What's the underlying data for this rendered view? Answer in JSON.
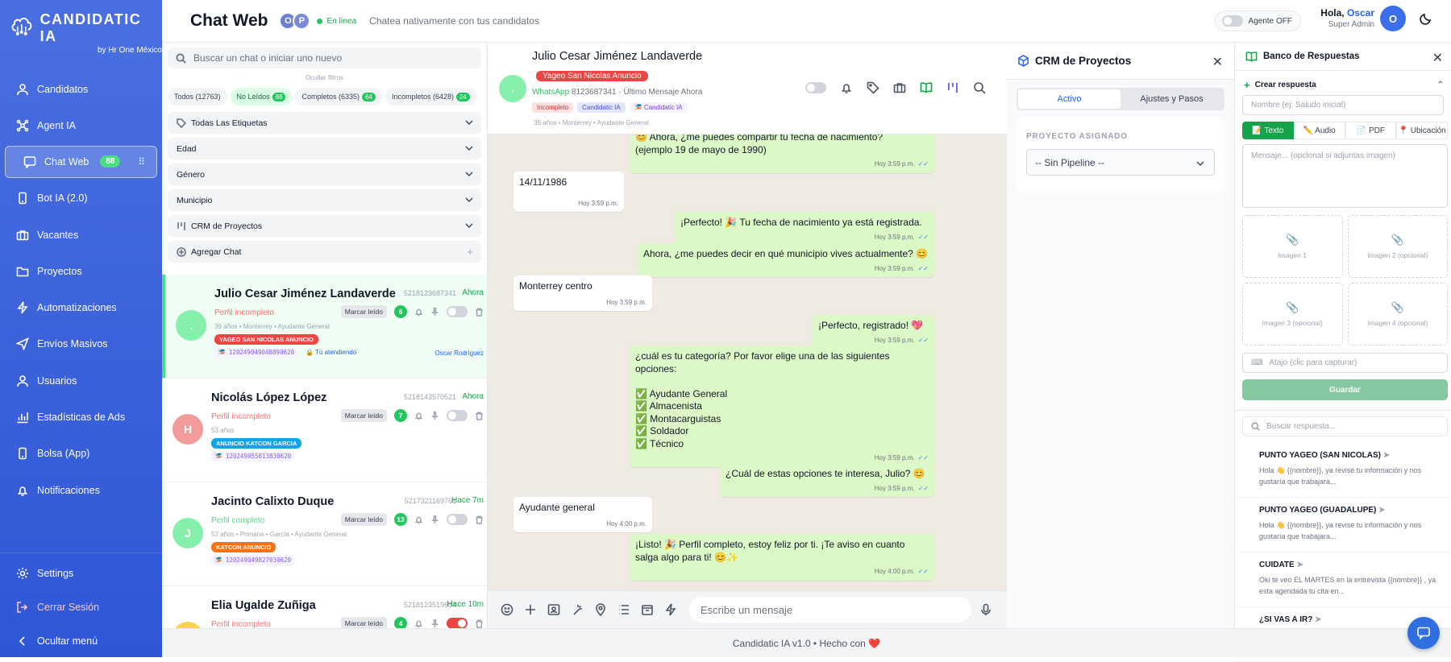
{
  "brand": {
    "title": "CANDIDATIC IA",
    "subtitle": "by Hr One México"
  },
  "nav": {
    "items": [
      {
        "label": "Candidatos"
      },
      {
        "label": "Agent IA"
      },
      {
        "label": "Chat Web",
        "badge": "88"
      },
      {
        "label": "Bot IA (2.0)"
      },
      {
        "label": "Vacantes"
      },
      {
        "label": "Proyectos"
      },
      {
        "label": "Automatizaciones"
      },
      {
        "label": "Envíos Masivos"
      },
      {
        "label": "Usuarios"
      },
      {
        "label": "Estadísticas de Ads"
      },
      {
        "label": "Bolsa (App)"
      },
      {
        "label": "Notificaciones"
      }
    ],
    "settings": "Settings",
    "logout": "Cerrar Sesión",
    "hide_menu": "Ocultar menú"
  },
  "topbar": {
    "title": "Chat Web",
    "avatars": [
      "O",
      "P"
    ],
    "online": "En línea",
    "subtitle": "Chatea nativamente con tus candidatos",
    "agent_label": "Agente OFF",
    "greeting": "Hola,",
    "user_name": "Oscar",
    "user_role": "Super Admin",
    "user_initial": "O"
  },
  "chatlist": {
    "search_placeholder": "Buscar un chat o iniciar uno nuevo",
    "hide_filters": "Ocultar filtros",
    "tabs": [
      {
        "label": "Todos (12763)"
      },
      {
        "label": "No Leídos",
        "count": "88"
      },
      {
        "label": "Completos (6335)",
        "count": "64"
      },
      {
        "label": "Incompletos (6428)",
        "count": "24"
      }
    ],
    "filters": [
      "Todas Las Etiquetas",
      "Edad",
      "Género",
      "Municipio",
      "CRM de Proyectos",
      "Agregar Chat"
    ],
    "items": [
      {
        "initial": ".",
        "name": "Julio Cesar Jiménez Landaverde",
        "phone": "5218123687341",
        "time": "Ahora",
        "status": "Perfil incompleto",
        "mark": "Marcar leído",
        "count": "6",
        "meta": "39 años  •  Monterrey  •  Ayudante General",
        "tag": "YAGEO SAN NICOLAS ANUNCIO",
        "id": "🎏 120249049048890620",
        "attending": "🔒 Tú atendiendo",
        "agent": "Oscar Rodríguez"
      },
      {
        "initial": "H",
        "name": "Nicolás López López",
        "phone": "5218143570521",
        "time": "Ahora",
        "status": "Perfil incompleto",
        "mark": "Marcar leído",
        "count": "7",
        "meta": "53 años",
        "tag": "ANUNCIO KATCON GARCIA",
        "id": "🎏 120249055813830620"
      },
      {
        "initial": "J",
        "name": "Jacinto Calixto Duque",
        "phone": "5217321169761",
        "time": "Hace 7m",
        "status": "Perfil completo",
        "mark": "Marcar leído",
        "count": "13",
        "meta": "52 años  •  Primaria  •  García  •  Ayudante General",
        "tag": "KATCON ANUNCIO",
        "id": "🎏 120249049827030620"
      },
      {
        "initial": "E",
        "name": "Elia Ugalde Zuñiga",
        "phone": "5218123519694",
        "time": "Hace 10m",
        "status": "Perfil incompleto",
        "mark": "Marcar leído",
        "count": "4"
      }
    ]
  },
  "conversation": {
    "name": "Julio Cesar Jiménez Landaverde",
    "tag": "Yageo San Nicolas Anuncio",
    "channel": "WhatsApp",
    "phone": "8123687341",
    "last": "Último Mensaje Ahora",
    "pills": [
      "Incompleto",
      "Candidatic IA",
      "🎏 Candidatic IA"
    ],
    "meta": "39 años  •  Monterrey  •  Ayudante General",
    "messages": [
      {
        "dir": "out",
        "text": "😊 Ahora, ¿me puedes compartir tu fecha de nacimiento?\n(ejemplo 19 de mayo de 1990)",
        "time": "Hoy 3:59 p.m."
      },
      {
        "dir": "in",
        "text": "14/11/1986",
        "time": "Hoy 3:59 p.m."
      },
      {
        "dir": "out",
        "text": "¡Perfecto! 🎉 Tu fecha de nacimiento ya está registrada.",
        "time": "Hoy 3:59 p.m."
      },
      {
        "dir": "out",
        "text": "Ahora, ¿me puedes decir en qué municipio vives actualmente? 😊",
        "time": "Hoy 3:59 p.m."
      },
      {
        "dir": "in",
        "text": "Monterrey centro",
        "time": "Hoy 3:59 p.m."
      },
      {
        "dir": "out",
        "text": "¡Perfecto, registrado! 💖",
        "time": "Hoy 3:59 p.m."
      },
      {
        "dir": "out",
        "text": "¿cuál es tu categoría? Por favor elige una de las siguientes\nopciones:\n\n✅ Ayudante General\n✅ Almacenista\n✅ Montacarguistas\n✅ Soldador\n✅ Técnico",
        "time": "Hoy 3:59 p.m."
      },
      {
        "dir": "out",
        "text": "¿Cuál de estas opciones te interesa, Julio? 😊",
        "time": "Hoy 3:59 p.m."
      },
      {
        "dir": "in",
        "text": "Ayudante general",
        "time": "Hoy 4:00 p.m."
      },
      {
        "dir": "out",
        "text": "¡Listo! 🎉 Perfil completo, estoy feliz por ti. ¡Te aviso en cuanto\nsalga algo para ti! 😊✨",
        "time": "Hoy 4:00 p.m."
      }
    ],
    "composer_placeholder": "Escribe un mensaje"
  },
  "crm": {
    "title": "CRM de Proyectos",
    "tab_active": "Activo",
    "tab_settings": "Ajustes y Pasos",
    "assigned_label": "PROYECTO ASIGNADO",
    "pipeline": "-- Sin Pipeline --"
  },
  "bank": {
    "title": "Banco de Respuestas",
    "create": "Crear respuesta",
    "name_placeholder": "Nombre (ej: Saludo inicial)",
    "types": [
      "📝 Texto",
      "✏️ Audio",
      "📄 PDF",
      "📍 Ubicación"
    ],
    "message_placeholder": "Mensaje... (opcional si adjuntas imagen)",
    "images": [
      "Imagen 1",
      "Imagen 2 (opcional)",
      "Imagen 3 (opcional)",
      "Imagen 4 (opcional)"
    ],
    "shortcut_placeholder": "Atajo (clic para capturar)",
    "save": "Guardar",
    "search_placeholder": "Buscar respuesta...",
    "responses": [
      {
        "title": "PUNTO YAGEO (SAN NICOLAS)",
        "text": "Hola 👋 {{nombre}}, ya revise tu información y nos gustaría que trabajara..."
      },
      {
        "title": "PUNTO YAGEO (GUADALUPE)",
        "text": "Hola 👋 {{nombre}}, ya revise tu información y nos gustaría que trabajara..."
      },
      {
        "title": "CUIDATE",
        "text": "Oki te veo EL MARTES en la entrevista {{nombre}} , ya esta agendada tu cita en..."
      },
      {
        "title": "¿SI VAS A IR?"
      }
    ]
  },
  "footer": "Candidatic IA v1.0 • Hecho con ❤️",
  "colors": {
    "sidebar": "#3b62dc",
    "accent": "#22c55e",
    "danger": "#ef4444",
    "bubble_out": "#dcf8c6",
    "chat_bg": "#efeae2"
  }
}
